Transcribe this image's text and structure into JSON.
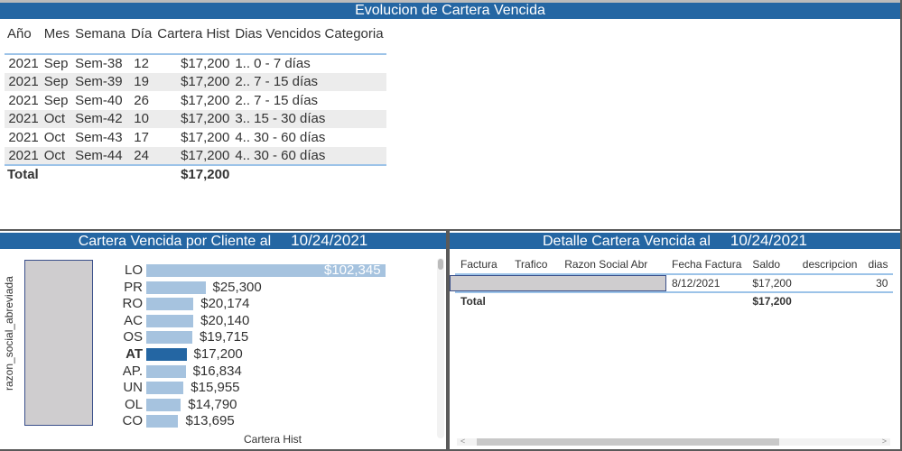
{
  "top": {
    "title": "Evolucion de Cartera Vencida",
    "headers": [
      "Año",
      "Mes",
      "Semana",
      "Día",
      "Cartera Hist",
      "Dias Vencidos Categoria"
    ],
    "rows": [
      [
        "2021",
        "Sep",
        "Sem-38",
        "12",
        "$17,200",
        "1.. 0 - 7 días"
      ],
      [
        "2021",
        "Sep",
        "Sem-39",
        "19",
        "$17,200",
        "2.. 7 - 15 días"
      ],
      [
        "2021",
        "Sep",
        "Sem-40",
        "26",
        "$17,200",
        "2.. 7 - 15 días"
      ],
      [
        "2021",
        "Oct",
        "Sem-42",
        "10",
        "$17,200",
        "3.. 15 - 30 días"
      ],
      [
        "2021",
        "Oct",
        "Sem-43",
        "17",
        "$17,200",
        "4.. 30 - 60 días"
      ],
      [
        "2021",
        "Oct",
        "Sem-44",
        "24",
        "$17,200",
        "4.. 30 - 60 días"
      ]
    ],
    "total_label": "Total",
    "total_value": "$17,200"
  },
  "chart": {
    "title": "Cartera Vencida por Cliente al",
    "date": "10/24/2021"
  },
  "chart_data": {
    "type": "bar",
    "orientation": "horizontal",
    "ylabel": "razon_social_abreviada",
    "xlabel": "Cartera Hist",
    "categories": [
      "LO",
      "PR",
      "RO",
      "AC",
      "OS",
      "AT",
      "AP.",
      "UN",
      "OL",
      "CO"
    ],
    "values": [
      102345,
      25300,
      20174,
      20140,
      19715,
      17200,
      16834,
      15955,
      14790,
      13695
    ],
    "data_labels": [
      "$102,345",
      "$25,300",
      "$20,174",
      "$20,140",
      "$19,715",
      "$17,200",
      "$16,834",
      "$15,955",
      "$14,790",
      "$13,695"
    ],
    "highlighted": "AT",
    "colors": {
      "bar": "#a6c3df",
      "highlight": "#2466a3"
    }
  },
  "detail": {
    "title": "Detalle Cartera Vencida al",
    "date": "10/24/2021",
    "headers": [
      "Factura",
      "Trafico",
      "Razon Social Abr",
      "Fecha Factura",
      "Saldo",
      "descripcion",
      "dias"
    ],
    "row": {
      "fecha": "8/12/2021",
      "saldo": "$17,200",
      "dias": "30"
    },
    "total_label": "Total",
    "total_value": "$17,200"
  },
  "colors": {
    "header": "#2466a3"
  }
}
